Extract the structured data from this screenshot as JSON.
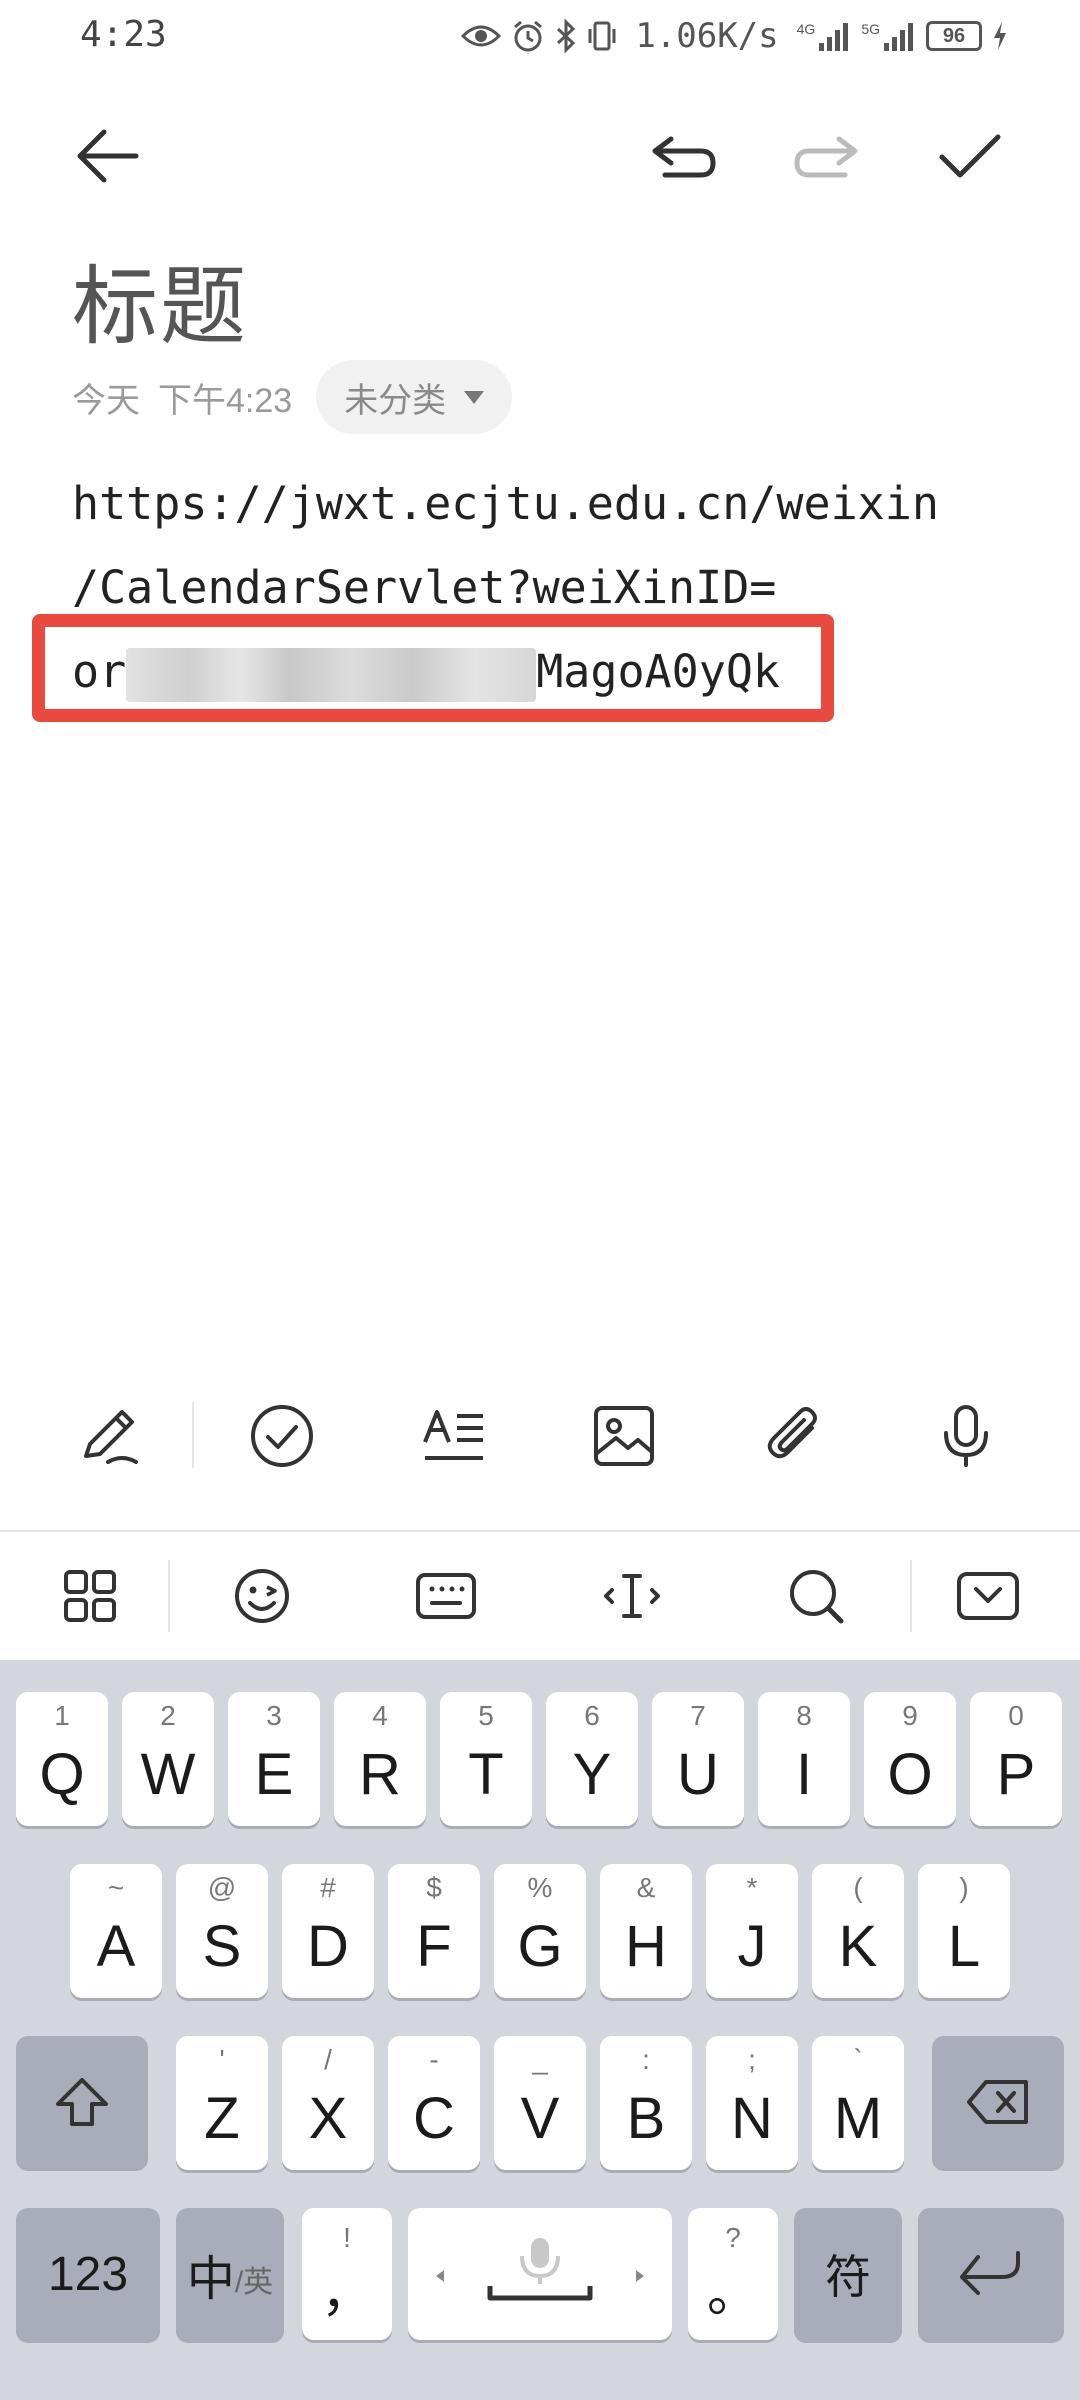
{
  "status_bar": {
    "time": "4:23",
    "network_speed": "1.06K/s",
    "signal_1_label": "4G",
    "signal_2_label": "5G",
    "battery": "96"
  },
  "toolbar": {
    "back_icon": "back-arrow-icon",
    "undo_icon": "undo-icon",
    "redo_icon": "redo-icon",
    "confirm_icon": "check-icon"
  },
  "note": {
    "title": "标题",
    "date": "今天",
    "time": "下午4:23",
    "category": "未分类",
    "body_line1": "https://jwxt.ecjtu.edu.cn/weixin",
    "body_line2": "/CalendarServlet?weiXinID=",
    "body_line3_prefix": "or",
    "body_line3_suffix": "MagoA0yQk"
  },
  "edit_toolbar": {
    "items": [
      "pen-icon",
      "checklist-icon",
      "text-format-icon",
      "image-icon",
      "attachment-icon",
      "microphone-icon"
    ]
  },
  "keyboard_toolbar": {
    "items": [
      "grid-menu-icon",
      "emoji-icon",
      "keyboard-icon",
      "cursor-icon",
      "search-icon",
      "hide-keyboard-icon"
    ]
  },
  "keyboard": {
    "row1": [
      {
        "main": "Q",
        "hint": "1"
      },
      {
        "main": "W",
        "hint": "2"
      },
      {
        "main": "E",
        "hint": "3"
      },
      {
        "main": "R",
        "hint": "4"
      },
      {
        "main": "T",
        "hint": "5"
      },
      {
        "main": "Y",
        "hint": "6"
      },
      {
        "main": "U",
        "hint": "7"
      },
      {
        "main": "I",
        "hint": "8"
      },
      {
        "main": "O",
        "hint": "9"
      },
      {
        "main": "P",
        "hint": "0"
      }
    ],
    "row2": [
      {
        "main": "A",
        "hint": "~"
      },
      {
        "main": "S",
        "hint": "@"
      },
      {
        "main": "D",
        "hint": "#"
      },
      {
        "main": "F",
        "hint": "$"
      },
      {
        "main": "G",
        "hint": "%"
      },
      {
        "main": "H",
        "hint": "&"
      },
      {
        "main": "J",
        "hint": "*"
      },
      {
        "main": "K",
        "hint": "("
      },
      {
        "main": "L",
        "hint": ")"
      }
    ],
    "row3": [
      {
        "main": "Z",
        "hint": "'"
      },
      {
        "main": "X",
        "hint": "/"
      },
      {
        "main": "C",
        "hint": "-"
      },
      {
        "main": "V",
        "hint": "_"
      },
      {
        "main": "B",
        "hint": ":"
      },
      {
        "main": "N",
        "hint": ";"
      },
      {
        "main": "M",
        "hint": "`"
      }
    ],
    "shift_icon": "shift-icon",
    "backspace_icon": "backspace-icon",
    "num_key": "123",
    "lang_main": "中",
    "lang_sub": "/英",
    "comma_main": "，",
    "comma_hint": "!",
    "period_main": "。",
    "period_hint": "?",
    "symbol_key": "符",
    "enter_icon": "enter-icon",
    "space_icon": "microphone-icon"
  }
}
